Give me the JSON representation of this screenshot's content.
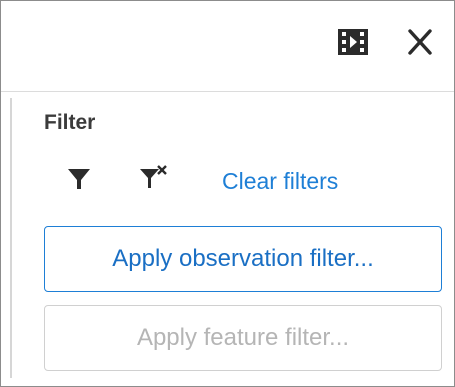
{
  "panel": {
    "title": "Filter"
  },
  "toolbar": {
    "panel_icon": "panel-toggle-icon",
    "close_icon": "close-icon"
  },
  "filter_row": {
    "filter_icon": "funnel-icon",
    "clear_filter_icon": "funnel-clear-icon",
    "clear_filters_label": "Clear filters"
  },
  "actions": {
    "apply_observation_label": "Apply observation filter...",
    "apply_feature_label": "Apply feature filter..."
  },
  "colors": {
    "accent": "#1e7fd6",
    "title_text": "#3b3b3b",
    "disabled_text": "#b5b5b5",
    "disabled_border": "#d0d0d0",
    "icon": "#2b2b2b"
  }
}
